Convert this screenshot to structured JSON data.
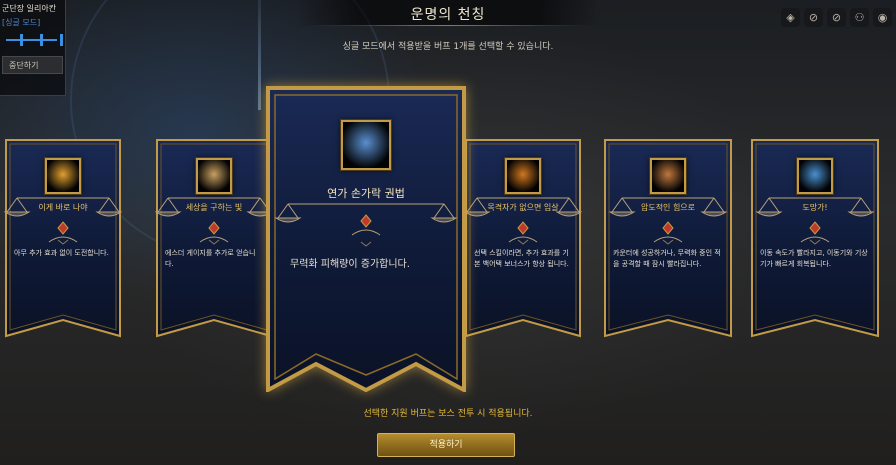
{
  "quest": {
    "title": "군단장 일리아칸",
    "mode": "[싱글 모드]",
    "stop_label": "중단하기"
  },
  "header": {
    "title": "운명의 천칭",
    "subtitle": "싱글 모드에서 적용받을 버프 1개를 선택할 수 있습니다."
  },
  "toolbar": {
    "icons": [
      "camera-settings-icon",
      "compass-icon",
      "no-entry-icon",
      "group-icon",
      "camera-icon"
    ],
    "glyphs": [
      "◈",
      "⊘",
      "⊘",
      "⚇",
      "◉"
    ]
  },
  "buffs": [
    {
      "name": "이게 바로 나야",
      "desc": "아무 추가 효과 없이 도전합니다.",
      "selected": false,
      "art_color": "#e0a030"
    },
    {
      "name": "세상을 구하는 빛",
      "desc": "에스더 게이지를 추가로 얻습니다.",
      "selected": false,
      "art_color": "#c8a060"
    },
    {
      "name": "연가 손가락 권법",
      "desc": "무력화 피해량이 증가합니다.",
      "selected": true,
      "art_color": "#5a8fd0"
    },
    {
      "name": "목격자가 없으면 임살",
      "desc": "선택 스킬이라면, 추가 효과를 기본 백어택 보너스가 항상 됩니다.",
      "selected": false,
      "art_color": "#d07820"
    },
    {
      "name": "압도적인 힘으로",
      "desc": "카운터에 성공하거나, 무력화 중인 적을 공격할 때 잠시 빨라집니다.",
      "selected": false,
      "art_color": "#c07840"
    },
    {
      "name": "도망가!",
      "desc": "이동 속도가 빨라지고, 이동기와 기상기가 빠르게 회복됩니다.",
      "selected": false,
      "art_color": "#4a90d0"
    }
  ],
  "footer": {
    "note": "선택한 지원 버프는 보스 전투 시 적용됩니다.",
    "apply_label": "적용하기"
  },
  "colors": {
    "gold": "#c39a45",
    "banner_blue": "#0f1a38",
    "name_gold": "#e9c564",
    "footer_gold": "#e3b83a"
  }
}
